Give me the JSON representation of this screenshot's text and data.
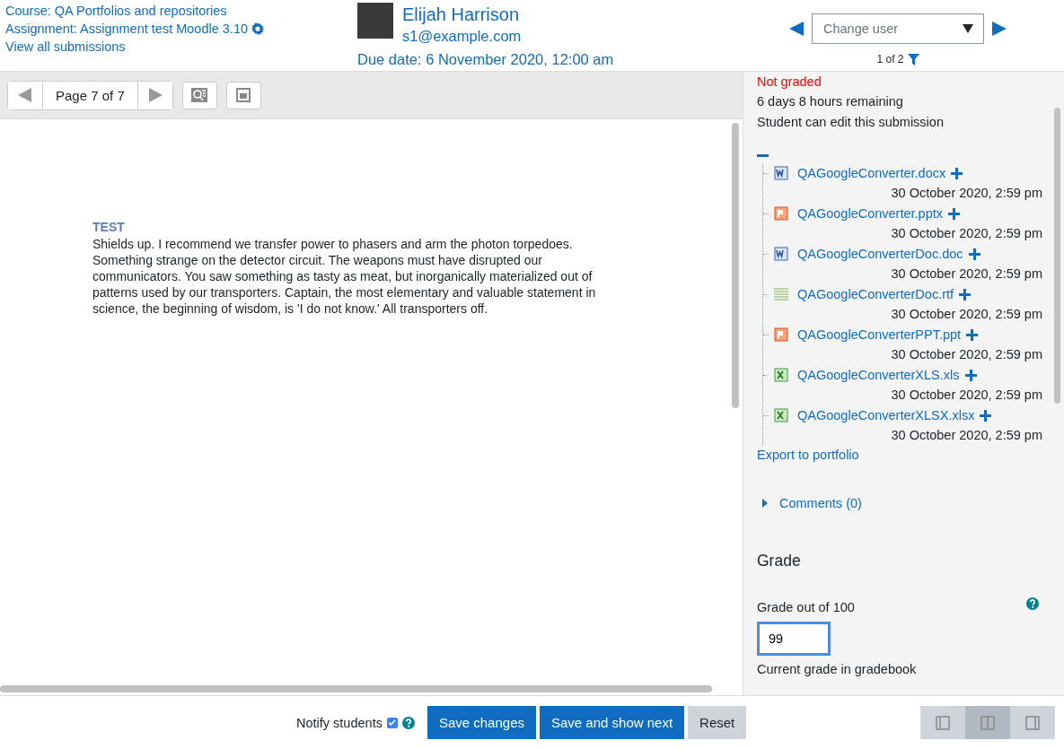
{
  "header": {
    "course_link": "Course: QA Portfolios and repositories",
    "assignment_link": "Assignment: Assignment test Moodle 3.10",
    "view_all_link": "View all submissions",
    "user_name": "Elijah Harrison",
    "user_email": "s1@example.com",
    "due_date": "Due date: 6 November 2020, 12:00 am",
    "change_user": {
      "placeholder": "Change user"
    },
    "counter": "1 of 2"
  },
  "toolbar": {
    "page_label": "Page 7 of 7"
  },
  "document": {
    "heading": "TEST",
    "paragraph": "Shields up. I recommend we transfer power to phasers and arm the photon torpedoes. Something strange on the detector circuit. The weapons must have disrupted our communicators. You saw something as tasty as meat, but inorganically materialized out of patterns used by our transporters. Captain, the most elementary and valuable statement in science, the beginning of wisdom, is 'I do not know.' All transporters off."
  },
  "status": {
    "grading_status": "Not graded",
    "time_remaining": "6 days 8 hours remaining",
    "edit_status": "Student can edit this submission"
  },
  "files": {
    "expanded": true,
    "items": [
      {
        "name": "QAGoogleConverter.docx",
        "kind": "word",
        "date": "30 October 2020, 2:59 pm"
      },
      {
        "name": "QAGoogleConverter.pptx",
        "kind": "powerpoint",
        "date": "30 October 2020, 2:59 pm"
      },
      {
        "name": "QAGoogleConverterDoc.doc",
        "kind": "word",
        "date": "30 October 2020, 2:59 pm"
      },
      {
        "name": "QAGoogleConverterDoc.rtf",
        "kind": "text",
        "date": "30 October 2020, 2:59 pm"
      },
      {
        "name": "QAGoogleConverterPPT.ppt",
        "kind": "powerpoint",
        "date": "30 October 2020, 2:59 pm"
      },
      {
        "name": "QAGoogleConverterXLS.xls",
        "kind": "excel",
        "date": "30 October 2020, 2:59 pm"
      },
      {
        "name": "QAGoogleConverterXLSX.xlsx",
        "kind": "excel",
        "date": "30 October 2020, 2:59 pm"
      }
    ]
  },
  "export_link": "Export to portfolio",
  "comments": {
    "label": "Comments (0)",
    "expanded": false
  },
  "grade": {
    "heading": "Grade",
    "label": "Grade out of 100",
    "value": "99",
    "current_label": "Current grade in gradebook"
  },
  "footer": {
    "notify_label": "Notify students",
    "notify_checked": true,
    "buttons": [
      "Save changes",
      "Save and show next",
      "Reset"
    ],
    "layout_buttons": [
      {
        "kind": "left",
        "selected": false
      },
      {
        "kind": "both",
        "selected": true
      },
      {
        "kind": "right",
        "selected": false
      }
    ]
  }
}
